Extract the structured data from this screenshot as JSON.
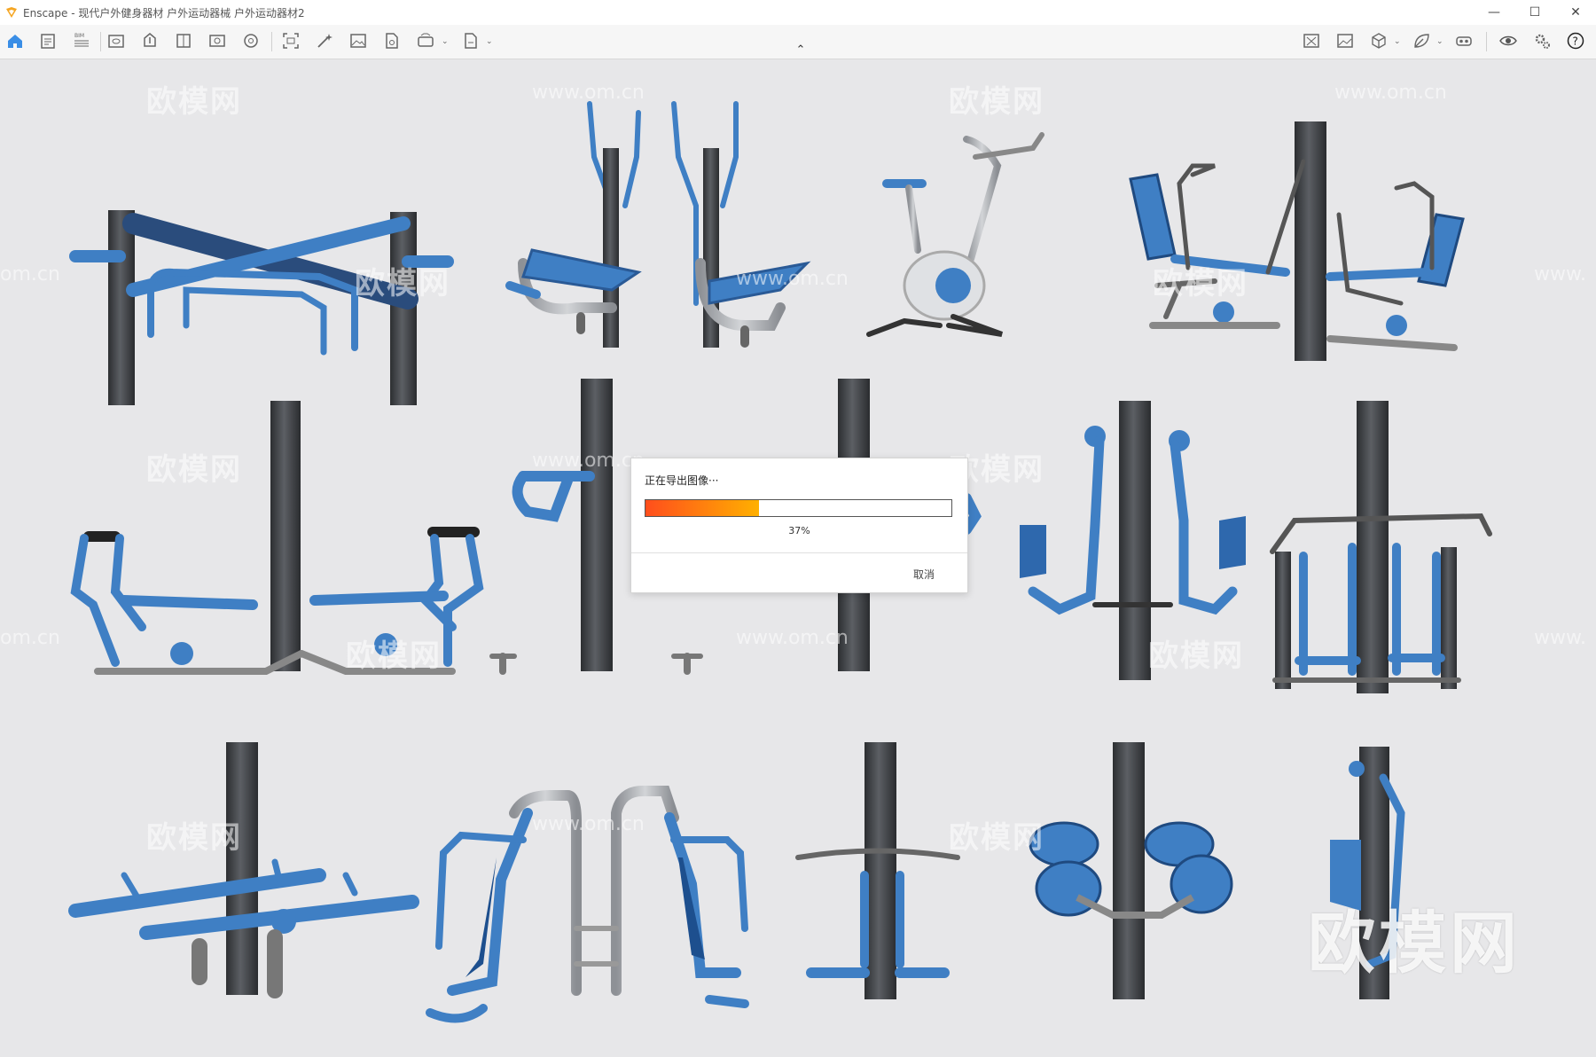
{
  "window": {
    "title": "Enscape - 现代户外健身器材 户外运动器械 户外运动器材2",
    "controls": [
      "minimize-icon",
      "maximize-icon",
      "close-icon"
    ]
  },
  "toolbar": {
    "left_icons": [
      "home-icon",
      "document-icon",
      "bim-icon",
      "view-icon",
      "upload-icon",
      "book-icon",
      "gallery-icon",
      "materials-icon",
      "capture-icon",
      "magic-icon",
      "image-icon",
      "file-export-icon",
      "panorama-icon",
      "export-icon"
    ],
    "right_icons": [
      "map-icon",
      "picture-icon",
      "cube-icon",
      "leaf-icon",
      "vr-icon",
      "eye-icon",
      "settings-icon",
      "help-icon"
    ],
    "accent": "#3a8ee6"
  },
  "watermarks": {
    "brand": "欧模网",
    "url": "www.om.cn",
    "url_short": "om.cn",
    "url_partial": "www."
  },
  "dialog": {
    "title": "正在导出图像···",
    "progress": 0.37,
    "progress_text": "37%",
    "cancel_label": "取消"
  },
  "colors": {
    "equipment_blue": "#3f7fc4",
    "post_dark": "#3d3f43",
    "silver": "#b6b9bd",
    "background": "#e7e7e9"
  }
}
